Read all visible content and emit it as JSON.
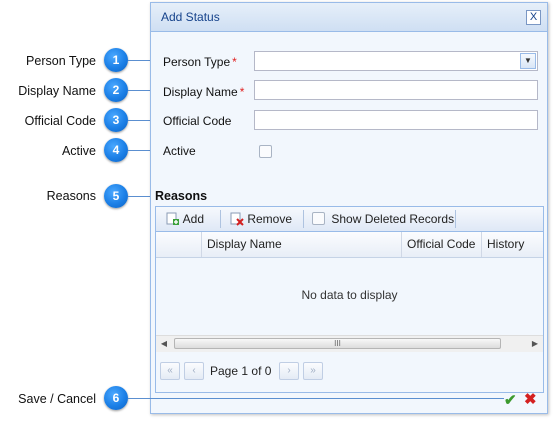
{
  "callouts": [
    {
      "label": "Person Type",
      "number": "1"
    },
    {
      "label": "Display Name",
      "number": "2"
    },
    {
      "label": "Official Code",
      "number": "3"
    },
    {
      "label": "Active",
      "number": "4"
    },
    {
      "label": "Reasons",
      "number": "5"
    },
    {
      "label": "Save /  Cancel",
      "number": "6"
    }
  ],
  "dialog": {
    "title": "Add Status",
    "close_glyph": "X",
    "fields": {
      "person_type": {
        "label": "Person Type",
        "required_mark": "*",
        "value": ""
      },
      "display_name": {
        "label": "Display Name",
        "required_mark": "*",
        "value": ""
      },
      "official_code": {
        "label": "Official Code",
        "value": ""
      },
      "active": {
        "label": "Active",
        "checked": false
      }
    },
    "reasons": {
      "title": "Reasons",
      "toolbar": {
        "add_label": "Add",
        "remove_label": "Remove",
        "show_deleted_label": "Show Deleted Records"
      },
      "columns": [
        "Display Name",
        "Official Code",
        "History"
      ],
      "empty_text": "No data to display",
      "scroll_thumb_glyph": "III",
      "pager": {
        "page_word": "Page",
        "page": "1",
        "of_word": "of",
        "total": "0"
      }
    }
  },
  "colors": {
    "accent": "#1b7fe6",
    "save": "#3c9a2e",
    "cancel": "#d42020",
    "required": "#e02020"
  },
  "icons": {
    "save": "check-icon",
    "cancel": "close-icon"
  }
}
